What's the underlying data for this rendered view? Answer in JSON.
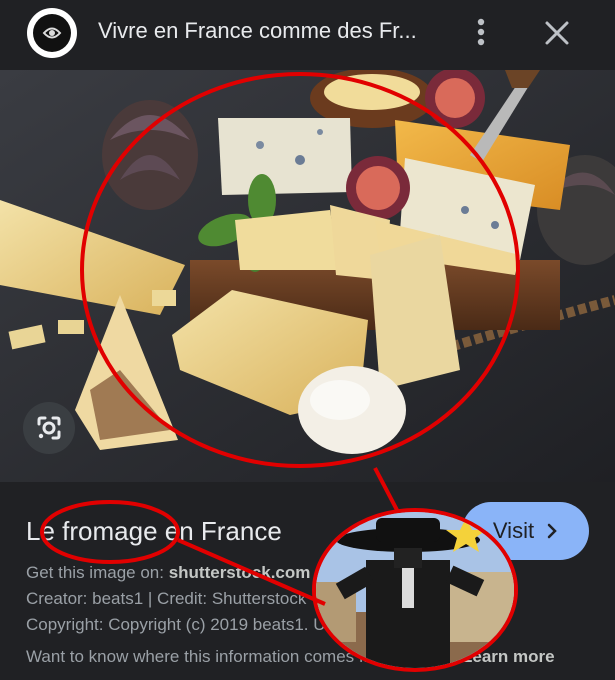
{
  "header": {
    "title": "Vivre en France comme des Fr...",
    "avatar_icon": "channel-avatar-icon",
    "menu_icon": "kebab-menu-icon",
    "close_icon": "close-icon"
  },
  "image": {
    "alt": "Cheese platter",
    "lens_icon": "google-lens-icon"
  },
  "result": {
    "caption": "Le fromage en France",
    "visit_label": "Visit",
    "source_prefix": "Get this image on: ",
    "source_name": "shutterstock.com",
    "creator_line": "Creator: beats1 | Credit: Shutterstock",
    "copyright_line": "Copyright: Copyright (c) 2019 beats1. Use with...",
    "info_prefix": "Want to know where this information comes from?",
    "learn_more": "Learn more"
  },
  "colors": {
    "background": "#202124",
    "accent": "#8ab4f8",
    "annotation_red": "#e10000"
  }
}
